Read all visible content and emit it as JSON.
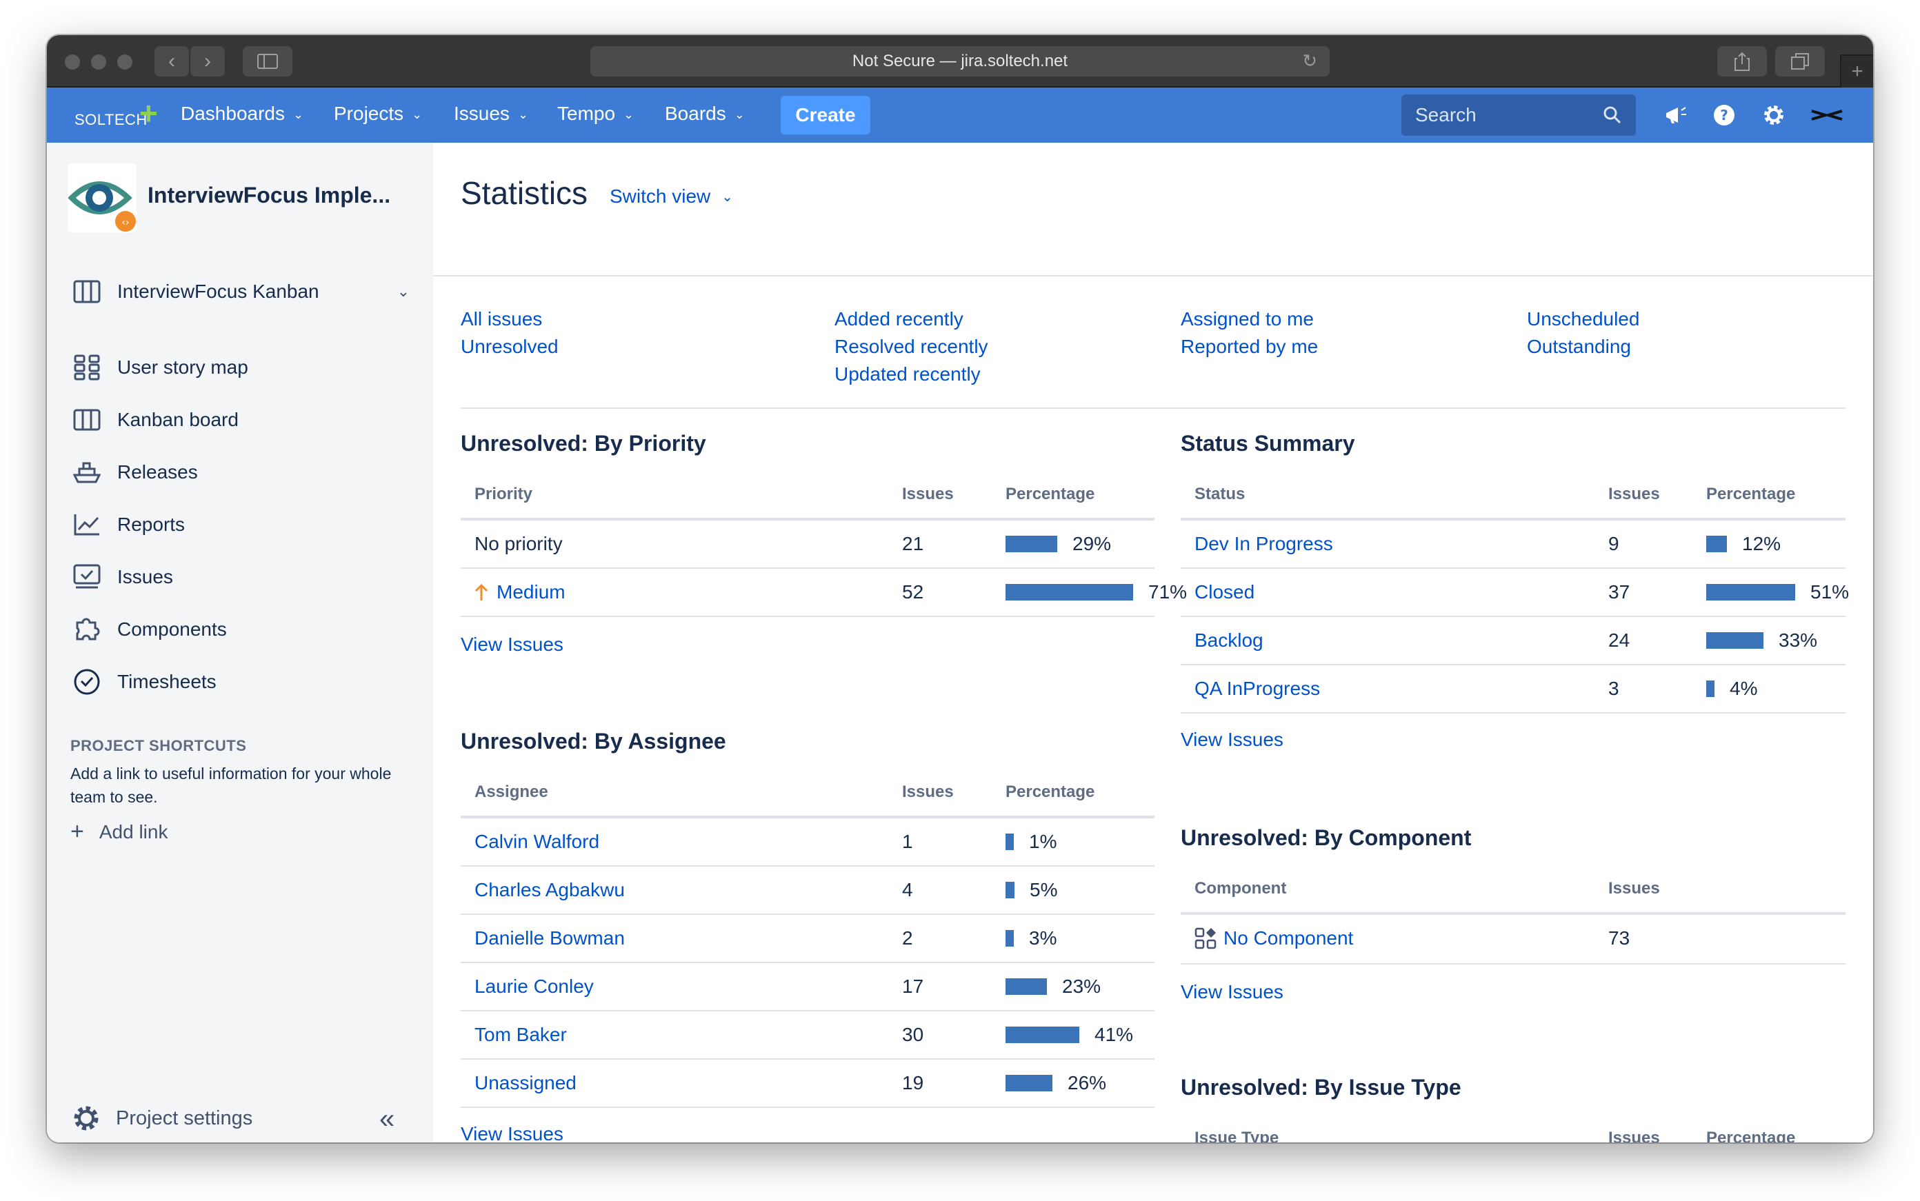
{
  "browser": {
    "url_text": "Not Secure — jira.soltech.net"
  },
  "nav": {
    "logo_text": "SOLTECH",
    "items": [
      "Dashboards",
      "Projects",
      "Issues",
      "Tempo",
      "Boards"
    ],
    "create_label": "Create",
    "search_placeholder": "Search"
  },
  "sidebar": {
    "project_name": "InterviewFocus Imple...",
    "board_name": "InterviewFocus Kanban",
    "items": [
      "User story map",
      "Kanban board",
      "Releases",
      "Reports",
      "Issues",
      "Components",
      "Timesheets"
    ],
    "shortcuts_title": "PROJECT SHORTCUTS",
    "shortcuts_desc": "Add a link to useful information for your whole team to see.",
    "add_link": "Add link",
    "settings": "Project settings"
  },
  "main": {
    "title": "Statistics",
    "switch_view": "Switch view",
    "filters": {
      "col1": [
        "All issues",
        "Unresolved"
      ],
      "col2": [
        "Added recently",
        "Resolved recently",
        "Updated recently"
      ],
      "col3": [
        "Assigned to me",
        "Reported by me"
      ],
      "col4": [
        "Unscheduled",
        "Outstanding"
      ]
    },
    "view_issues": "View Issues",
    "priority": {
      "title": "Unresolved: By Priority",
      "headers": [
        "Priority",
        "Issues",
        "Percentage"
      ],
      "rows": [
        {
          "name": "No priority",
          "issues": "21",
          "pct": "29%",
          "frac": 0.29,
          "link": false
        },
        {
          "name": "Medium",
          "issues": "52",
          "pct": "71%",
          "frac": 0.71,
          "link": true
        }
      ]
    },
    "assignee": {
      "title": "Unresolved: By Assignee",
      "headers": [
        "Assignee",
        "Issues",
        "Percentage"
      ],
      "rows": [
        {
          "name": "Calvin Walford",
          "issues": "1",
          "pct": "1%",
          "frac": 0.01
        },
        {
          "name": "Charles Agbakwu",
          "issues": "4",
          "pct": "5%",
          "frac": 0.05
        },
        {
          "name": "Danielle Bowman",
          "issues": "2",
          "pct": "3%",
          "frac": 0.03
        },
        {
          "name": "Laurie Conley",
          "issues": "17",
          "pct": "23%",
          "frac": 0.23
        },
        {
          "name": "Tom Baker",
          "issues": "30",
          "pct": "41%",
          "frac": 0.41
        },
        {
          "name": "Unassigned",
          "issues": "19",
          "pct": "26%",
          "frac": 0.26
        }
      ]
    },
    "status": {
      "title": "Status Summary",
      "headers": [
        "Status",
        "Issues",
        "Percentage"
      ],
      "rows": [
        {
          "name": "Dev In Progress",
          "issues": "9",
          "pct": "12%",
          "frac": 0.12
        },
        {
          "name": "Closed",
          "issues": "37",
          "pct": "51%",
          "frac": 0.51
        },
        {
          "name": "Backlog",
          "issues": "24",
          "pct": "33%",
          "frac": 0.33
        },
        {
          "name": "QA InProgress",
          "issues": "3",
          "pct": "4%",
          "frac": 0.04
        }
      ]
    },
    "component": {
      "title": "Unresolved: By Component",
      "headers": [
        "Component",
        "Issues"
      ],
      "rows": [
        {
          "name": "No Component",
          "issues": "73"
        }
      ]
    },
    "issue_type": {
      "title": "Unresolved: By Issue Type",
      "headers": [
        "Issue Type",
        "Issues",
        "Percentage"
      ]
    }
  }
}
